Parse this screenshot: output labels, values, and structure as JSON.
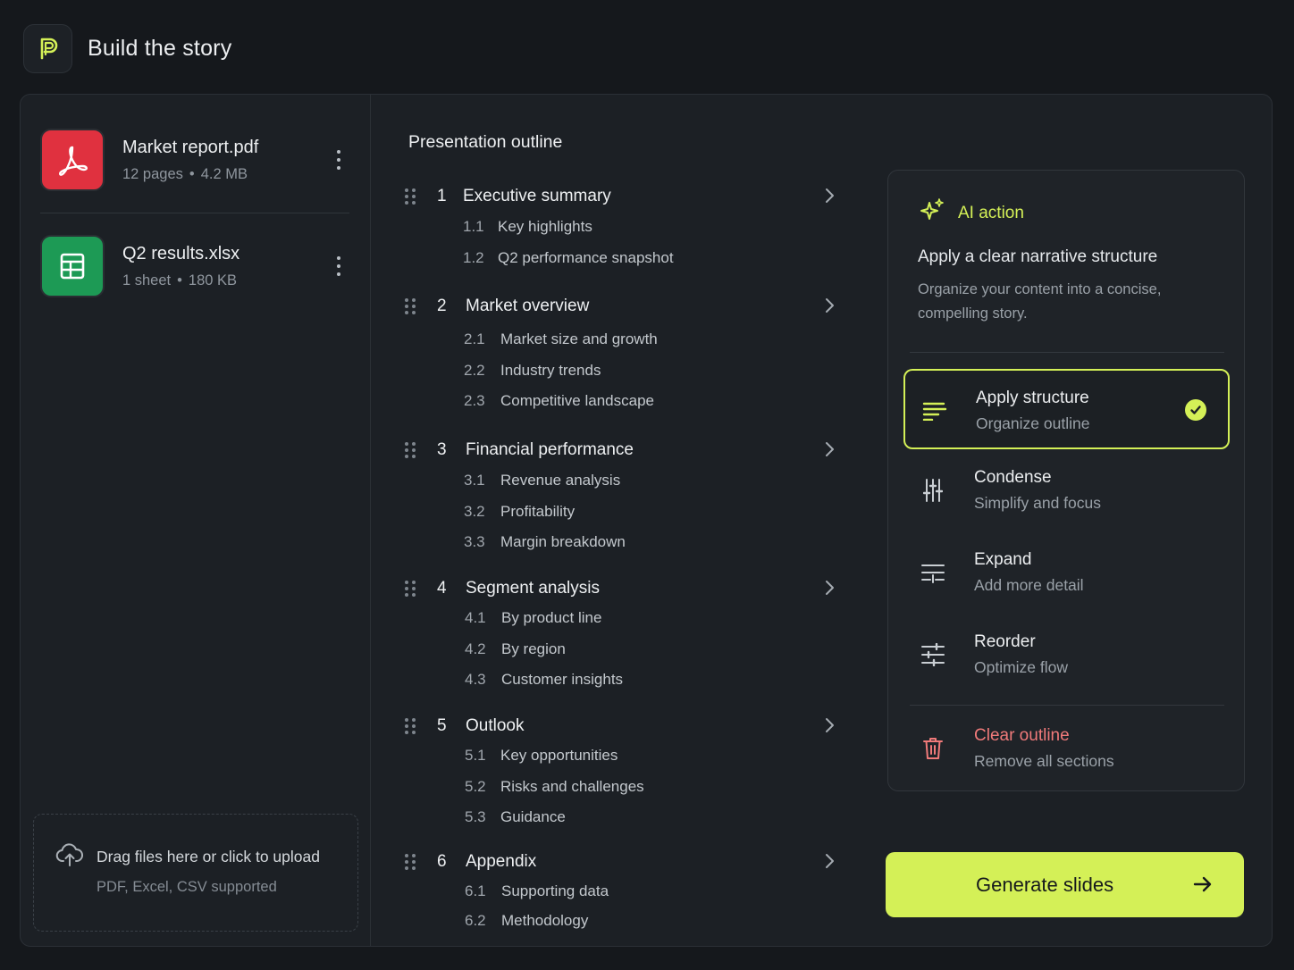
{
  "app": {
    "title": "Build the story",
    "logo_icon": "p-logo-icon"
  },
  "files": [
    {
      "name": "Market report.pdf",
      "count": "12 pages",
      "size": "4.2 MB",
      "type": "pdf"
    },
    {
      "name": "Q2 results.xlsx",
      "count": "1 sheet",
      "size": "180 KB",
      "type": "xlsx"
    }
  ],
  "upload": {
    "title": "Drag files here or click to upload",
    "subtitle": "PDF, Excel, CSV supported"
  },
  "outline": {
    "title": "Presentation outline",
    "sections": [
      {
        "num": "1",
        "title": "Executive summary",
        "subs": [
          {
            "num": "1.1",
            "title": "Key highlights"
          },
          {
            "num": "1.2",
            "title": "Q2 performance snapshot"
          }
        ]
      },
      {
        "num": "2",
        "title": "Market overview",
        "subs": [
          {
            "num": "2.1",
            "title": "Market size and growth"
          },
          {
            "num": "2.2",
            "title": "Industry trends"
          },
          {
            "num": "2.3",
            "title": "Competitive landscape"
          }
        ]
      },
      {
        "num": "3",
        "title": "Financial performance",
        "subs": [
          {
            "num": "3.1",
            "title": "Revenue analysis"
          },
          {
            "num": "3.2",
            "title": "Profitability"
          },
          {
            "num": "3.3",
            "title": "Margin breakdown"
          }
        ]
      },
      {
        "num": "4",
        "title": "Segment analysis",
        "subs": [
          {
            "num": "4.1",
            "title": "By product line"
          },
          {
            "num": "4.2",
            "title": "By region"
          },
          {
            "num": "4.3",
            "title": "Customer insights"
          }
        ]
      },
      {
        "num": "5",
        "title": "Outlook",
        "subs": [
          {
            "num": "5.1",
            "title": "Key opportunities"
          },
          {
            "num": "5.2",
            "title": "Risks and challenges"
          },
          {
            "num": "5.3",
            "title": "Guidance"
          }
        ]
      },
      {
        "num": "6",
        "title": "Appendix",
        "subs": [
          {
            "num": "6.1",
            "title": "Supporting data"
          },
          {
            "num": "6.2",
            "title": "Methodology"
          }
        ]
      }
    ]
  },
  "ai": {
    "label": "AI action",
    "heading": "Apply a clear narrative structure",
    "description": "Organize your content into a concise, compelling story.",
    "actions": [
      {
        "title": "Apply structure",
        "subtitle": "Organize outline",
        "icon": "align-lines-icon",
        "selected": true
      },
      {
        "title": "Condense",
        "subtitle": "Simplify and focus",
        "icon": "sliders-vertical-icon"
      },
      {
        "title": "Expand",
        "subtitle": "Add more detail",
        "icon": "expand-lines-icon"
      },
      {
        "title": "Reorder",
        "subtitle": "Optimize flow",
        "icon": "sliders-horizontal-icon"
      }
    ],
    "clear": {
      "title": "Clear outline",
      "subtitle": "Remove all sections",
      "icon": "trash-icon"
    }
  },
  "generate": {
    "label": "Generate slides"
  },
  "colors": {
    "accent": "#d4f057",
    "danger": "#f07a7a",
    "pdf": "#e0313f",
    "xlsx": "#1d9a55",
    "background": "#15181c",
    "panel": "#1c2025"
  }
}
